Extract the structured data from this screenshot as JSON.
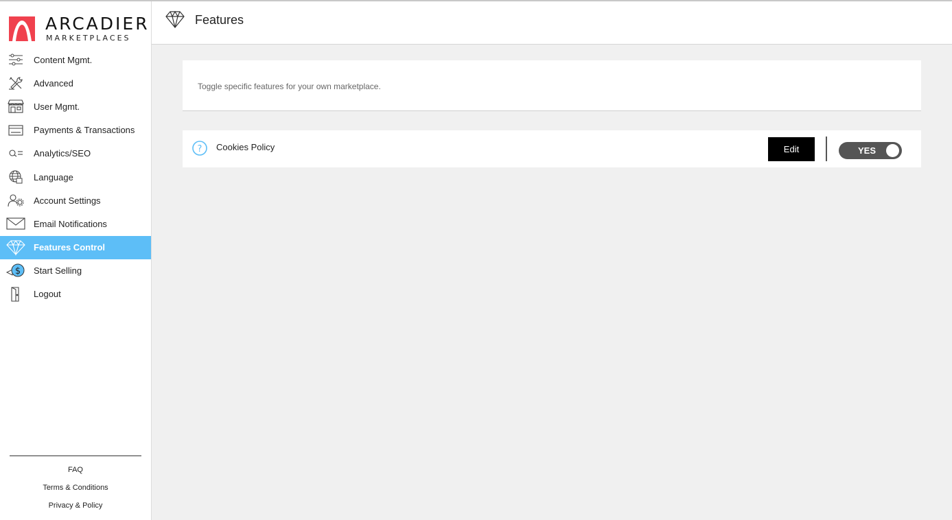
{
  "brand": {
    "name": "ARCADIER",
    "subtitle": "MARKETPLACES",
    "color": "#f0414e"
  },
  "sidebar": {
    "items": [
      {
        "label": "Content Mgmt.",
        "icon": "sliders-icon",
        "active": false
      },
      {
        "label": "Advanced",
        "icon": "tools-icon",
        "active": false
      },
      {
        "label": "User Mgmt.",
        "icon": "storefront-icon",
        "active": false
      },
      {
        "label": "Payments & Transactions",
        "icon": "credit-card-icon",
        "active": false
      },
      {
        "label": "Analytics/SEO",
        "icon": "magnifier-icon",
        "active": false
      },
      {
        "label": "Language",
        "icon": "globe-icon",
        "active": false
      },
      {
        "label": "Account Settings",
        "icon": "user-gear-icon",
        "active": false
      },
      {
        "label": "Email Notifications",
        "icon": "envelope-icon",
        "active": false
      },
      {
        "label": "Features Control",
        "icon": "diamond-icon",
        "active": true
      },
      {
        "label": "Start Selling",
        "icon": "dollar-coin-icon",
        "active": false
      },
      {
        "label": "Logout",
        "icon": "door-icon",
        "active": false
      }
    ],
    "footer": [
      "FAQ",
      "Terms & Conditions",
      "Privacy & Policy"
    ],
    "active_color": "#5dbef7"
  },
  "header": {
    "title": "Features",
    "icon": "diamond-icon"
  },
  "intro": {
    "text": "Toggle specific features for your own marketplace."
  },
  "features": [
    {
      "name": "Cookies Policy",
      "edit_label": "Edit",
      "toggle_label": "YES",
      "enabled": true
    }
  ]
}
